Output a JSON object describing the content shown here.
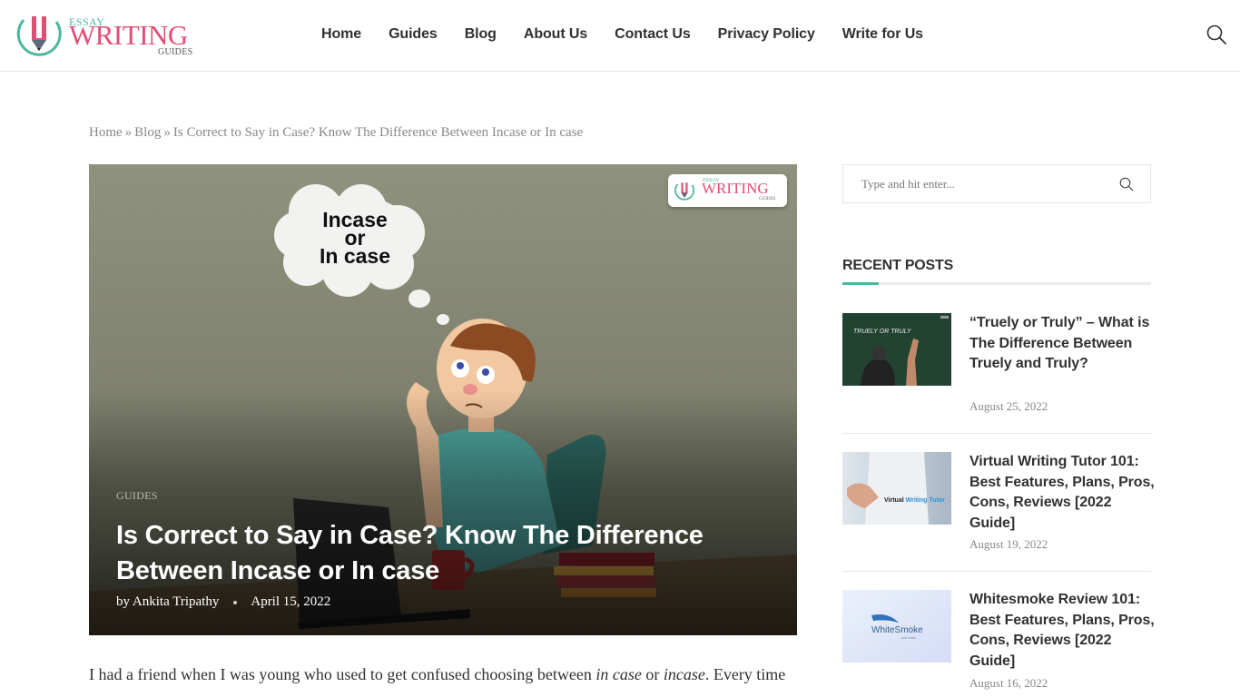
{
  "site": {
    "logo": {
      "top": "ESSAY",
      "main": "WRITING",
      "bottom": "GUIDES"
    },
    "brand_colors": {
      "pink": "#e14e73",
      "teal": "#4cb6a1",
      "text": "#313131",
      "muted": "#888888"
    }
  },
  "nav": {
    "items": [
      {
        "label": "Home"
      },
      {
        "label": "Guides"
      },
      {
        "label": "Blog"
      },
      {
        "label": "About Us"
      },
      {
        "label": "Contact Us"
      },
      {
        "label": "Privacy Policy"
      },
      {
        "label": "Write for Us"
      }
    ],
    "search_icon": "search-icon"
  },
  "breadcrumb": {
    "items": [
      "Home",
      "Blog"
    ],
    "separator": "»",
    "current": "Is Correct to Say in Case? Know The Difference Between Incase or In case"
  },
  "hero": {
    "image_text": [
      "Incase",
      "or",
      "In case"
    ],
    "category": "GUIDES",
    "title": "Is Correct to Say in Case? Know The Difference Between Incase or In case",
    "author": "by Ankita Tripathy",
    "date": "April 15, 2022",
    "badge": {
      "top": "ESSAY",
      "main": "WRITING",
      "bottom": "GUIDES"
    }
  },
  "article": {
    "intro_parts": [
      "I had a friend when I was young who used to get confused choosing between ",
      "in case",
      " or ",
      "incase",
      ". Every time"
    ]
  },
  "sidebar": {
    "search_placeholder": "Type and hit enter...",
    "recent_posts_title": "RECENT POSTS",
    "recent_posts": [
      {
        "title": "“Truely or Truly” – What is The Difference Between Truely and Truly?",
        "date": "August 25, 2022",
        "thumb_text": "TRUELY OR TRULY"
      },
      {
        "title": "Virtual Writing Tutor 101: Best Features, Plans, Pros, Cons, Reviews [2022 Guide]",
        "date": "August 19, 2022",
        "thumb_text": "Virtual Writing Tutor"
      },
      {
        "title": "Whitesmoke Review 101: Best Features, Plans, Pros, Cons, Reviews [2022 Guide]",
        "date": "August 16, 2022",
        "thumb_text": "WhiteSmoke"
      }
    ]
  }
}
